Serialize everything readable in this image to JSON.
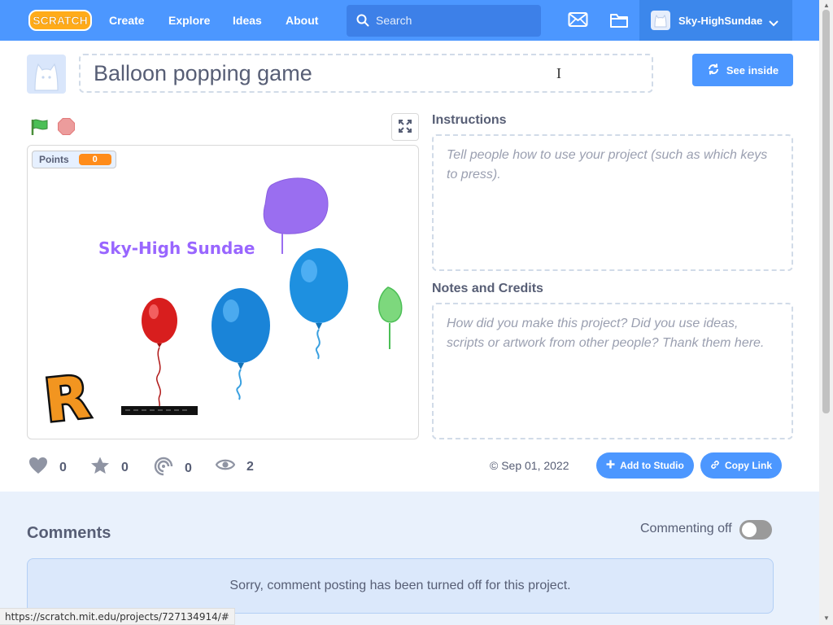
{
  "nav": {
    "logo_text": "SCRATCH",
    "links": [
      "Create",
      "Explore",
      "Ideas",
      "About"
    ],
    "search_placeholder": "Search",
    "account_name": "Sky-HighSundae"
  },
  "project": {
    "title": "Balloon popping game",
    "see_inside_label": "See inside"
  },
  "stage": {
    "monitor_label": "Points",
    "monitor_value": "0",
    "title_text": "Sky-High Sundae",
    "letter": "R"
  },
  "stats": {
    "loves": "0",
    "favorites": "0",
    "remixes": "0",
    "views": "2"
  },
  "share": {
    "date": "© Sep 01, 2022",
    "add_to_studio_label": "Add to Studio",
    "copy_link_label": "Copy Link"
  },
  "instructions": {
    "label": "Instructions",
    "placeholder": "Tell people how to use your project (such as which keys to press)."
  },
  "notes": {
    "label": "Notes and Credits",
    "placeholder": "How did you make this project? Did you use ideas, scripts or artwork from other people? Thank them here."
  },
  "comments": {
    "title": "Comments",
    "toggle_label": "Commenting off",
    "notice": "Sorry, comment posting has been turned off for this project."
  },
  "status_bar": {
    "url": "https://scratch.mit.edu/projects/727134914/#"
  },
  "colors": {
    "brand_blue": "#4c97ff",
    "monitor_orange": "#ff8c1a",
    "stage_title_purple": "#9966ff"
  }
}
